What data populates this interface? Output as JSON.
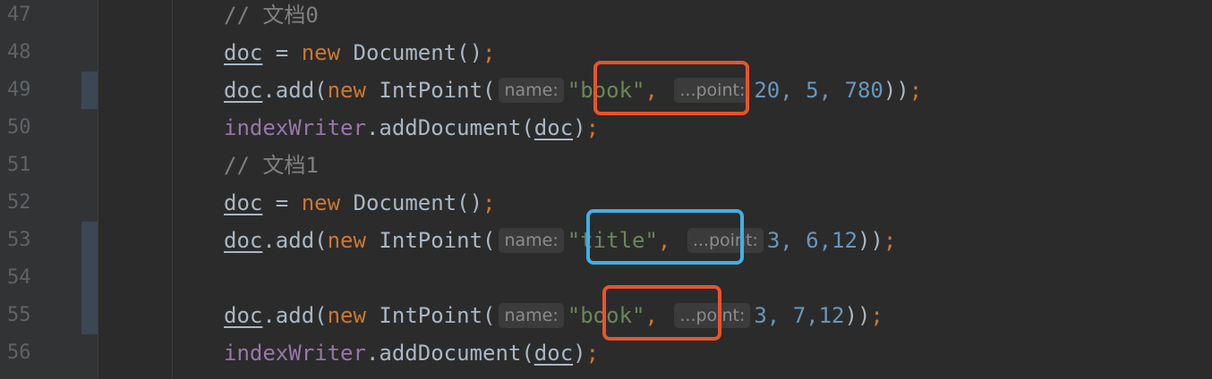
{
  "editor": {
    "colors": {
      "background": "#2b2b2b",
      "gutter": "#313335",
      "keyword": "#cc7832",
      "string": "#6a8759",
      "number": "#6897bb",
      "field": "#9876aa",
      "comment": "#808080",
      "highlight_orange": "#e8532d",
      "highlight_blue": "#3fb1e8"
    },
    "lines": [
      {
        "num": "47",
        "comment": "// 文档0"
      },
      {
        "num": "48",
        "var": "doc",
        "eq": " = ",
        "kw": "new",
        "rest": " Document()",
        "semi": ";"
      },
      {
        "num": "49",
        "var": "doc",
        "call": ".add(",
        "kw": "new",
        "cls": " IntPoint(",
        "hint1": "name:",
        "str": "\"book\"",
        "comma": ",",
        "hint2": "...point:",
        "nums": "20, 5, 780",
        "close": "))",
        "semi": ";"
      },
      {
        "num": "50",
        "fld": "indexWriter",
        "call": ".addDocument(",
        "arg": "doc",
        "close": ")",
        "semi": ";"
      },
      {
        "num": "51",
        "comment": "// 文档1"
      },
      {
        "num": "52",
        "var": "doc",
        "eq": " = ",
        "kw": "new",
        "rest": " Document()",
        "semi": ";"
      },
      {
        "num": "53",
        "var": "doc",
        "call": ".add(",
        "kw": "new",
        "cls": " IntPoint(",
        "hint1": "name:",
        "str": "\"title\"",
        "comma": ",",
        "hint2": "...point:",
        "nums": "3, 6,12",
        "close": "))",
        "semi": ";"
      },
      {
        "num": "54"
      },
      {
        "num": "55",
        "var": "doc",
        "call": ".add(",
        "kw": "new",
        "cls": " IntPoint(",
        "hint1": "name:",
        "str": "\"book\"",
        "comma": ",",
        "hint2": "...point:",
        "nums": "3, 7,12",
        "close": "))",
        "semi": ";"
      },
      {
        "num": "56",
        "fld": "indexWriter",
        "call": ".addDocument(",
        "arg": "doc",
        "close": ")",
        "semi": ";"
      }
    ]
  }
}
